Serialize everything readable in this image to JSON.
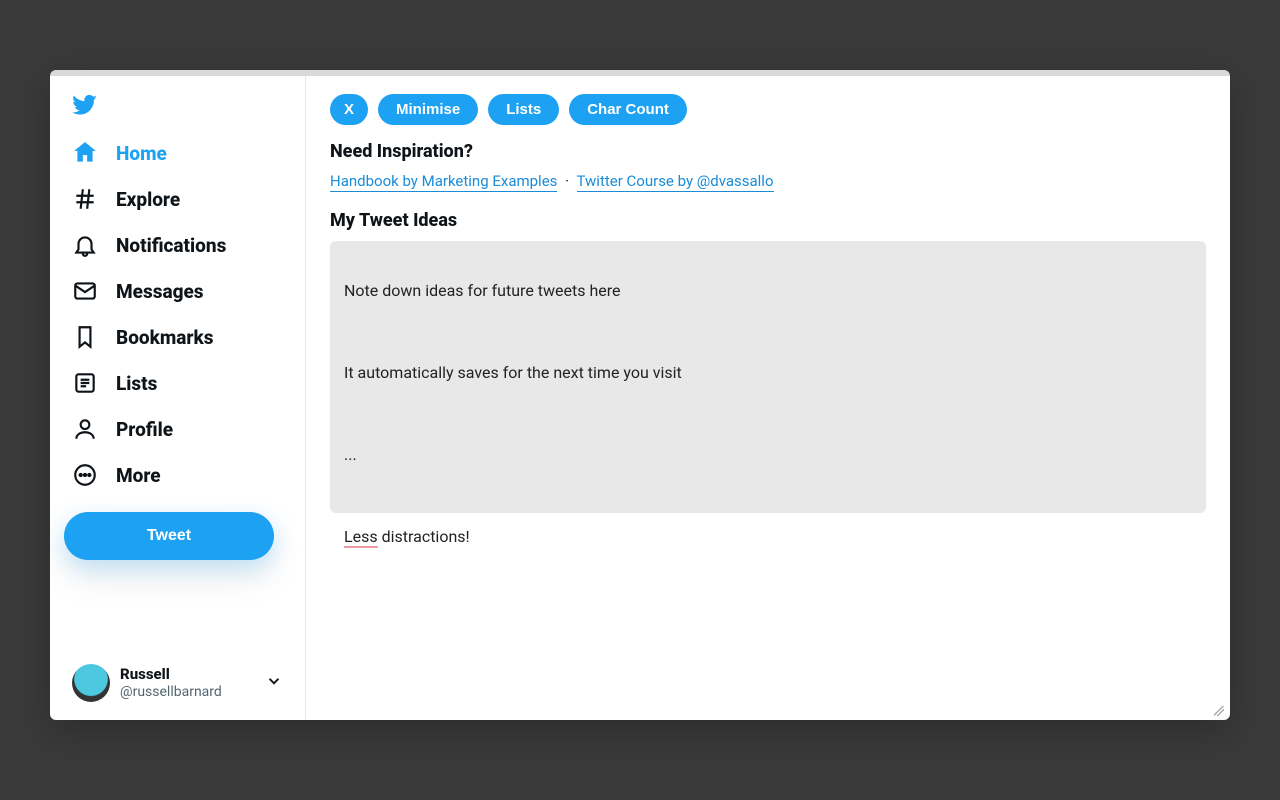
{
  "sidebar": {
    "items": [
      {
        "label": "Home",
        "icon": "home-icon",
        "active": true
      },
      {
        "label": "Explore",
        "icon": "hash-icon"
      },
      {
        "label": "Notifications",
        "icon": "bell-icon"
      },
      {
        "label": "Messages",
        "icon": "envelope-icon"
      },
      {
        "label": "Bookmarks",
        "icon": "bookmark-icon"
      },
      {
        "label": "Lists",
        "icon": "list-icon"
      },
      {
        "label": "Profile",
        "icon": "profile-icon"
      },
      {
        "label": "More",
        "icon": "more-icon"
      }
    ],
    "tweet_button": "Tweet"
  },
  "account": {
    "name": "Russell",
    "handle": "@russellbarnard"
  },
  "toolbar": {
    "close": "X",
    "minimise": "Minimise",
    "lists": "Lists",
    "char_count": "Char Count"
  },
  "inspiration": {
    "heading": "Need Inspiration?",
    "link1": "Handbook by Marketing Examples",
    "separator": "·",
    "link2": "Twitter Course by @dvassallo"
  },
  "ideas": {
    "heading": "My Tweet Ideas",
    "line1": "Note down ideas for future tweets here",
    "line2": "It automatically saves for the next time you visit",
    "line3": "...",
    "underlined_word": "Less",
    "line4_rest": " distractions!"
  }
}
